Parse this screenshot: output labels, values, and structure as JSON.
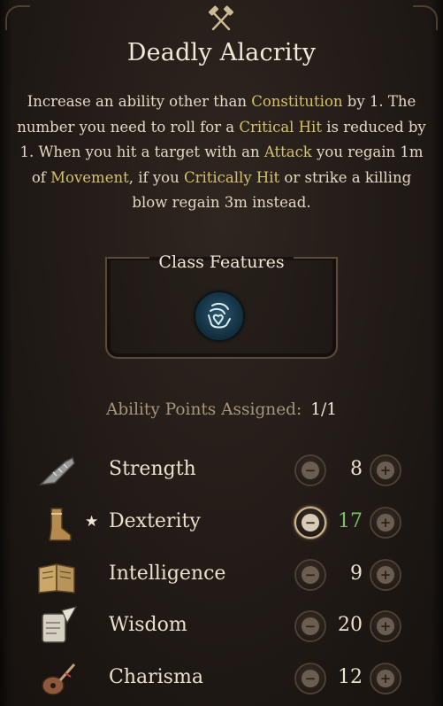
{
  "header": {
    "icon": "crossed-hammers-icon",
    "title": "Deadly Alacrity"
  },
  "description": {
    "parts": [
      {
        "text": "Increase an ability other than ",
        "hl": false
      },
      {
        "text": "Constitution",
        "hl": true
      },
      {
        "text": " by 1. The number you need to roll for a ",
        "hl": false
      },
      {
        "text": "Critical Hit",
        "hl": true
      },
      {
        "text": " is reduced by 1. When you hit a target with an ",
        "hl": false
      },
      {
        "text": "Attack",
        "hl": true
      },
      {
        "text": " you regain 1m of ",
        "hl": false
      },
      {
        "text": "Movement",
        "hl": true
      },
      {
        "text": ", if you ",
        "hl": false
      },
      {
        "text": "Critically Hit",
        "hl": true
      },
      {
        "text": " or strike a killing blow regain 3m instead.",
        "hl": false
      }
    ],
    "highlight_color": "#d7c16a"
  },
  "class_features": {
    "label": "Class Features",
    "icon": "hand-heart-icon"
  },
  "ability_points": {
    "label": "Ability Points Assigned:",
    "value": "1/1"
  },
  "abilities": [
    {
      "name": "Strength",
      "value": "8",
      "icon": "gauntlet-icon",
      "selected": false
    },
    {
      "name": "Dexterity",
      "value": "17",
      "icon": "boot-icon",
      "selected": true
    },
    {
      "name": "Intelligence",
      "value": "9",
      "icon": "open-book-icon",
      "selected": false
    },
    {
      "name": "Wisdom",
      "value": "20",
      "icon": "scroll-quill-icon",
      "selected": false
    },
    {
      "name": "Charisma",
      "value": "12",
      "icon": "lute-icon",
      "selected": false
    }
  ],
  "controls": {
    "minus_symbol": "−",
    "plus_symbol": "+",
    "star_symbol": "★"
  },
  "colors": {
    "increased_value": "#7ac06a",
    "title": "#f2ead9",
    "label_muted": "#a8957b"
  }
}
